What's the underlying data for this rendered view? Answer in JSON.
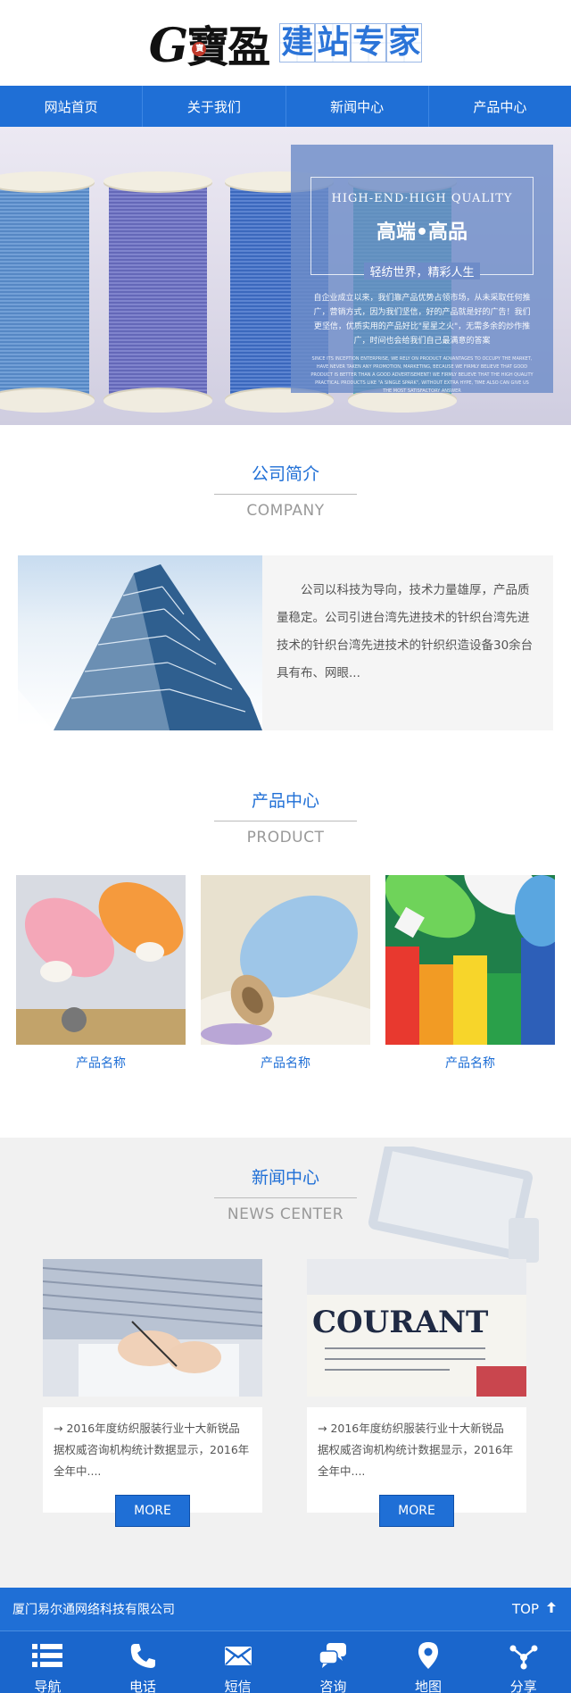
{
  "header": {
    "logo_text": "寶盈",
    "logo_boxes": [
      "建",
      "站",
      "专",
      "家"
    ],
    "seal_text": "寶"
  },
  "nav": [
    "网站首页",
    "关于我们",
    "新闻中心",
    "产品中心"
  ],
  "banner": {
    "en_title": "HIGH-END·HIGH QUALITY",
    "cn_title": "高端•高品",
    "subtitle": "轻纺世界，精彩人生",
    "body": "自企业成立以来，我们靠产品优势占领市场，从未采取任何推广，营销方式，因为我们坚信，好的产品就是好的广告！我们更坚信，优质实用的产品好比\"星星之火\"，无需多余的炒作推广，时间也会给我们自己最满意的答案",
    "en_body": "Since its inception enterprise, we rely on product advantages to occupy the market, have never taken any promotion, marketing, because we firmly believe that good product is better than a good advertisement! We firmly believe that the high quality practical products like \"a single spark\", without extra hype, time also can give us the most satisfactory answer"
  },
  "company": {
    "title_cn": "公司简介",
    "title_en": "COMPANY",
    "text": "公司以科技为导向，技术力量雄厚，产品质量稳定。公司引进台湾先进技术的针织台湾先进技术的针织台湾先进技术的针织织造设备30余台具有布、网眼..."
  },
  "products": {
    "title_cn": "产品中心",
    "title_en": "PRODUCT",
    "items": [
      {
        "name": "产品名称"
      },
      {
        "name": "产品名称"
      },
      {
        "name": "产品名称"
      }
    ]
  },
  "news": {
    "title_cn": "新闻中心",
    "title_en": "NEWS CENTER",
    "items": [
      {
        "title": "→ 2016年度纺织服装行业十大新锐品",
        "text": "据权威咨询机构统计数据显示，2016年全年中....",
        "more": "MORE"
      },
      {
        "title": "→ 2016年度纺织服装行业十大新锐品",
        "text": "据权威咨询机构统计数据显示，2016年全年中....",
        "more": "MORE"
      }
    ],
    "paper_text": "COURANT"
  },
  "footer": {
    "company": "厦门易尔通网络科技有限公司",
    "top_label": "TOP"
  },
  "tabbar": [
    {
      "label": "导航",
      "icon": "menu-icon"
    },
    {
      "label": "电话",
      "icon": "phone-icon"
    },
    {
      "label": "短信",
      "icon": "mail-icon"
    },
    {
      "label": "咨询",
      "icon": "chat-icon"
    },
    {
      "label": "地图",
      "icon": "map-pin-icon"
    },
    {
      "label": "分享",
      "icon": "share-icon"
    }
  ]
}
